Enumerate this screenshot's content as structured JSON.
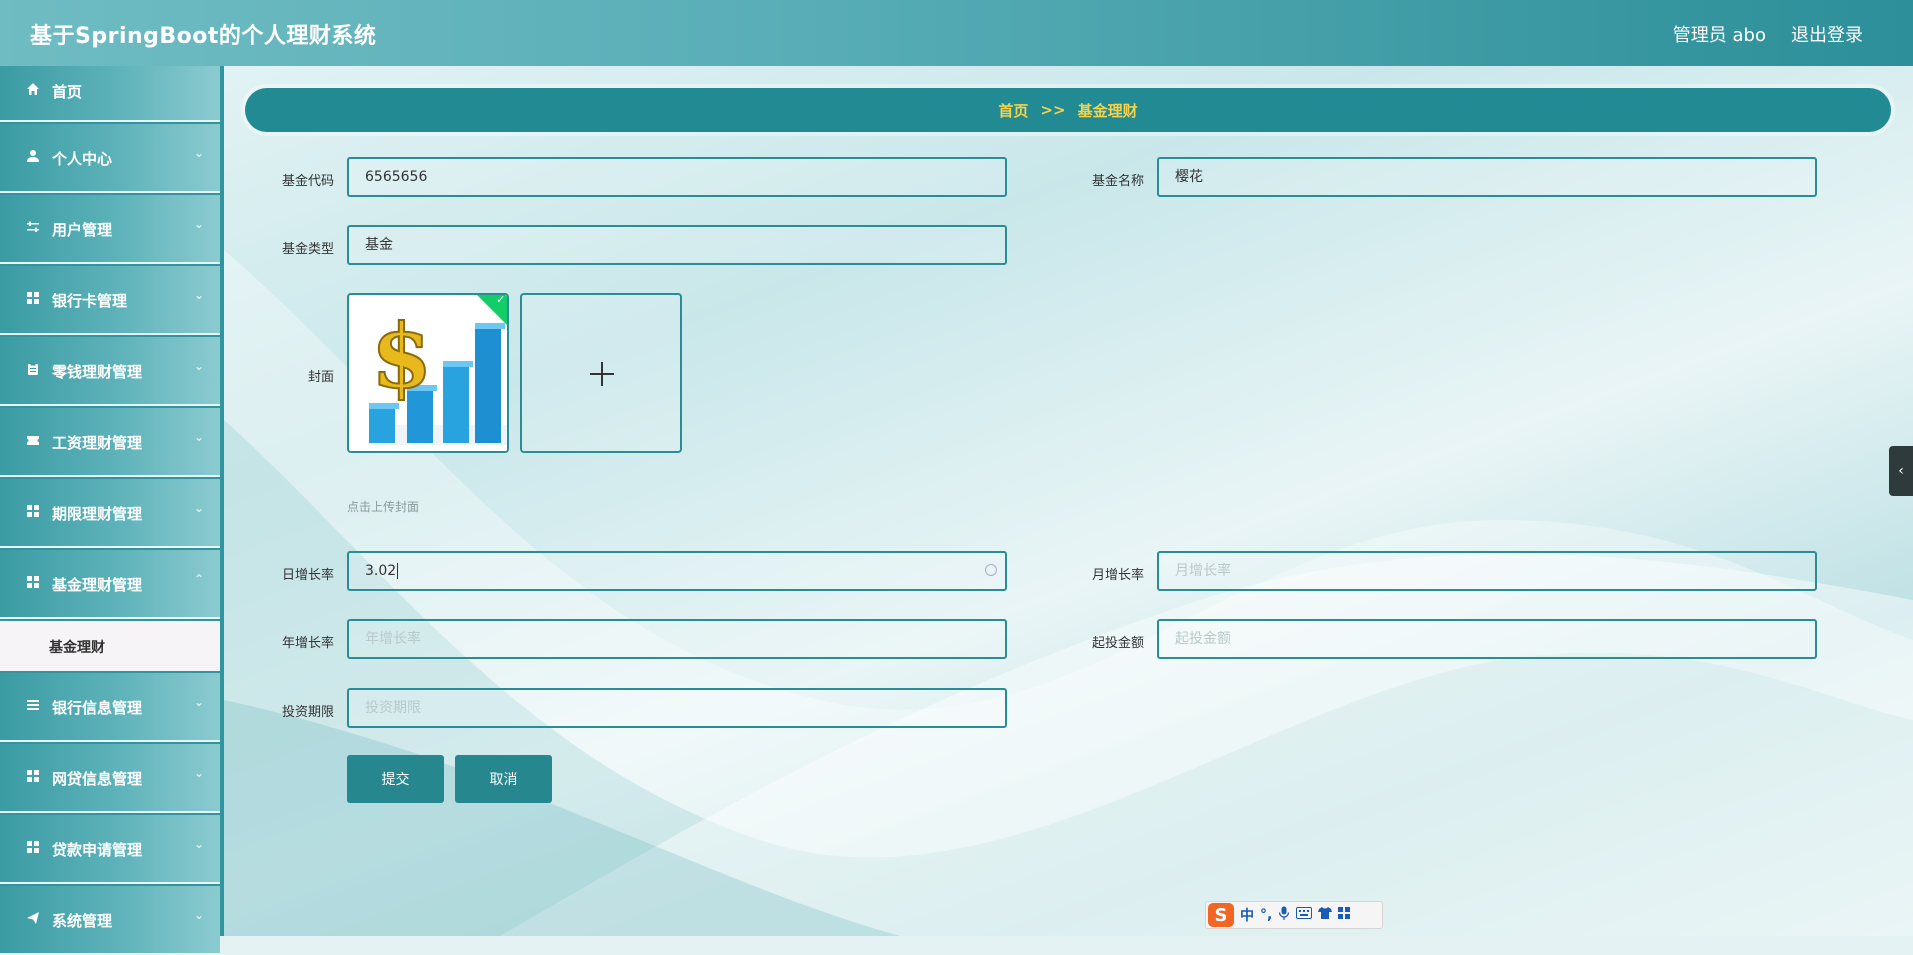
{
  "header": {
    "title": "基于SpringBoot的个人理财系统",
    "user": "管理员 abo",
    "logout": "退出登录"
  },
  "sidebar": {
    "items": [
      {
        "label": "首页",
        "icon": "home-icon"
      },
      {
        "label": "个人中心",
        "icon": "user-icon"
      },
      {
        "label": "用户管理",
        "icon": "sliders-icon"
      },
      {
        "label": "银行卡管理",
        "icon": "grid-icon"
      },
      {
        "label": "零钱理财管理",
        "icon": "clipboard-icon"
      },
      {
        "label": "工资理财管理",
        "icon": "ticket-icon"
      },
      {
        "label": "期限理财管理",
        "icon": "grid-icon"
      },
      {
        "label": "基金理财管理",
        "icon": "grid-icon"
      },
      {
        "label": "基金理财",
        "icon": ""
      },
      {
        "label": "银行信息管理",
        "icon": "list-icon"
      },
      {
        "label": "网贷信息管理",
        "icon": "grid-icon"
      },
      {
        "label": "贷款申请管理",
        "icon": "grid-icon"
      },
      {
        "label": "系统管理",
        "icon": "send-icon"
      }
    ]
  },
  "breadcrumb": {
    "home": "首页",
    "separator": ">>",
    "current": "基金理财"
  },
  "form": {
    "fund_code": {
      "label": "基金代码",
      "value": "6565656"
    },
    "fund_name": {
      "label": "基金名称",
      "value": "樱花"
    },
    "fund_type": {
      "label": "基金类型",
      "value": "基金"
    },
    "cover": {
      "label": "封面",
      "hint": "点击上传封面"
    },
    "daily_rate": {
      "label": "日增长率",
      "value": "3.02"
    },
    "monthly_rate": {
      "label": "月增长率",
      "placeholder": "月增长率"
    },
    "yearly_rate": {
      "label": "年增长率",
      "placeholder": "年增长率"
    },
    "min_invest": {
      "label": "起投金额",
      "placeholder": "起投金额"
    },
    "term": {
      "label": "投资期限",
      "placeholder": "投资期限"
    },
    "submit": "提交",
    "cancel": "取消"
  },
  "ime": {
    "logo": "S",
    "mode": "中",
    "punct": "°,"
  },
  "colors": {
    "primary": "#228a92",
    "breadcrumb_text": "#f2d34a",
    "check": "#13ce66"
  }
}
